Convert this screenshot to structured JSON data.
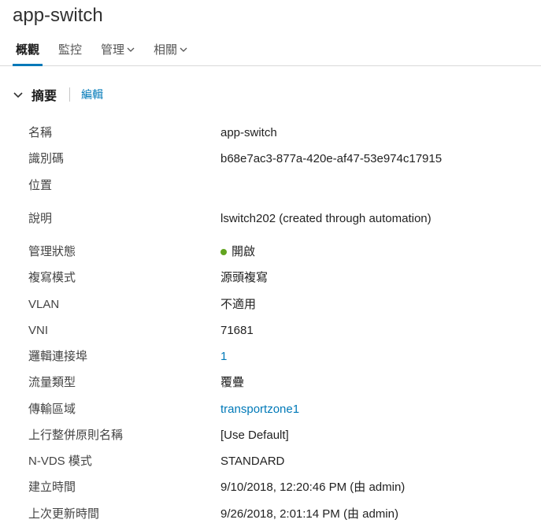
{
  "title": "app-switch",
  "tabs": {
    "overview": "概觀",
    "monitor": "監控",
    "manage": "管理",
    "related": "相關"
  },
  "section": {
    "summary": "摘要",
    "edit": "編輯"
  },
  "labels": {
    "name": "名稱",
    "id": "識別碼",
    "location": "位置",
    "description": "說明",
    "adminStatus": "管理狀態",
    "replicationMode": "複寫模式",
    "vlan": "VLAN",
    "vni": "VNI",
    "logicalPorts": "邏輯連接埠",
    "trafficType": "流量類型",
    "transportZone": "傳輸區域",
    "uplinkTeamingPolicyName": "上行整併原則名稱",
    "nvdsMode": "N-VDS 模式",
    "created": "建立時間",
    "lastModified": "上次更新時間"
  },
  "values": {
    "name": "app-switch",
    "id": "b68e7ac3-877a-420e-af47-53e974c17915",
    "location": "",
    "description": "lswitch202 (created through automation)",
    "adminStatus": "開啟",
    "replicationMode": "源頭複寫",
    "vlan": "不適用",
    "vni": "71681",
    "logicalPorts": "1",
    "trafficType": "覆疊",
    "transportZone": "transportzone1",
    "uplinkTeamingPolicyName": "[Use Default]",
    "nvdsMode": "STANDARD",
    "created": "9/10/2018, 12:20:46 PM (由 admin)",
    "lastModified": "9/26/2018, 2:01:14 PM (由 admin)"
  }
}
